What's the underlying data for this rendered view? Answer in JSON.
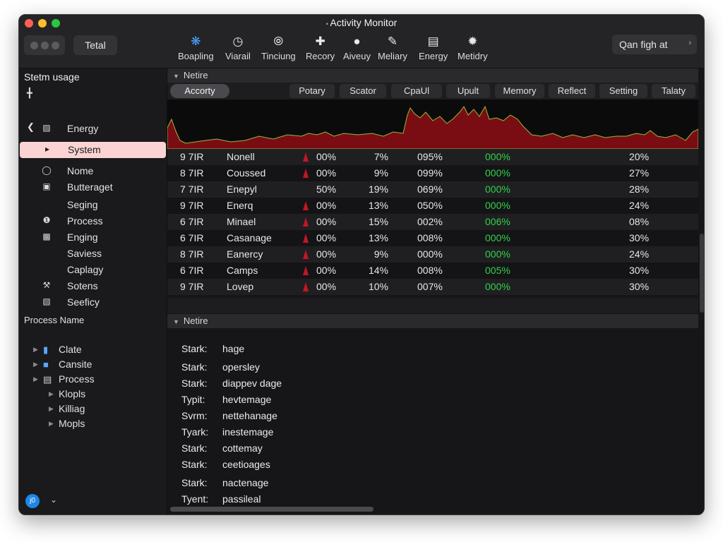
{
  "window": {
    "title": "Activity Monitor"
  },
  "toolbar": {
    "total_label": "Tetal",
    "tools": [
      {
        "label": "Boapling",
        "icon": "cpu-gear-icon"
      },
      {
        "label": "Viarail",
        "icon": "clock-icon"
      },
      {
        "label": "Tinciung",
        "icon": "gauge-icon"
      },
      {
        "label": "Recory",
        "icon": "plus-icon"
      },
      {
        "label": "Aiveuy",
        "icon": "apple-icon"
      },
      {
        "label": "Meliary",
        "icon": "edit-icon"
      },
      {
        "label": "Energy",
        "icon": "list-icon"
      },
      {
        "label": "Metidry",
        "icon": "aperture-icon"
      }
    ],
    "search_value": "Qan figh at"
  },
  "sidebar": {
    "heading": "Stetm usage",
    "items": [
      {
        "label": "Energy",
        "icon": "battery-icon"
      },
      {
        "label": "System",
        "icon": "play-icon"
      },
      {
        "label": "Nome",
        "icon": "chat-icon"
      },
      {
        "label": "Butteraget",
        "icon": "box-icon"
      },
      {
        "label": "Seging",
        "icon": ""
      },
      {
        "label": "Process",
        "icon": "info-icon"
      },
      {
        "label": "Enging",
        "icon": "disk-icon"
      },
      {
        "label": "Saviess",
        "icon": ""
      },
      {
        "label": "Caplagy",
        "icon": ""
      },
      {
        "label": "Sotens",
        "icon": "wrench-icon"
      },
      {
        "label": "Seeficy",
        "icon": "book-icon"
      }
    ],
    "section_label": "Process Name",
    "tree": [
      {
        "label": "Clate",
        "icon": "file-icon"
      },
      {
        "label": "Cansite",
        "icon": "folder-icon"
      },
      {
        "label": "Process",
        "icon": "drive-icon"
      },
      {
        "label": "Klopls"
      },
      {
        "label": "Killiag"
      },
      {
        "label": "Mopls"
      }
    ],
    "avatar_text": "j0"
  },
  "main": {
    "section_one": "Netire",
    "section_two": "Netire",
    "columns": [
      "Accorty",
      "Potary",
      "Scator",
      "CpaUl",
      "Upult",
      "Memory",
      "Reflect",
      "Setting",
      "Talaty"
    ],
    "rows": [
      {
        "pid": "9 7IR",
        "name": "Nonell",
        "cpu": "00%",
        "time": "7%",
        "threads": "095%",
        "idle": "000%",
        "pct": "20%",
        "mark": true
      },
      {
        "pid": "8 7IR",
        "name": "Coussed",
        "cpu": "00%",
        "time": "9%",
        "threads": "099%",
        "idle": "000%",
        "pct": "27%",
        "mark": true
      },
      {
        "pid": "7 7IR",
        "name": "Enepyl",
        "cpu": "50%",
        "time": "19%",
        "threads": "069%",
        "idle": "000%",
        "pct": "28%",
        "mark": false
      },
      {
        "pid": "9 7IR",
        "name": "Enerq",
        "cpu": "00%",
        "time": "13%",
        "threads": "050%",
        "idle": "000%",
        "pct": "24%",
        "mark": true
      },
      {
        "pid": "6 7IR",
        "name": "Minael",
        "cpu": "00%",
        "time": "15%",
        "threads": "002%",
        "idle": "006%",
        "pct": "08%",
        "mark": true
      },
      {
        "pid": "6 7IR",
        "name": "Casanage",
        "cpu": "00%",
        "time": "13%",
        "threads": "008%",
        "idle": "000%",
        "pct": "30%",
        "mark": true
      },
      {
        "pid": "8 7IR",
        "name": "Eanercy",
        "cpu": "00%",
        "time": "9%",
        "threads": "000%",
        "idle": "000%",
        "pct": "24%",
        "mark": true
      },
      {
        "pid": "6 7IR",
        "name": "Camps",
        "cpu": "00%",
        "time": "14%",
        "threads": "008%",
        "idle": "005%",
        "pct": "30%",
        "mark": true
      },
      {
        "pid": "9 7IR",
        "name": "Lovep",
        "cpu": "00%",
        "time": "10%",
        "threads": "007%",
        "idle": "000%",
        "pct": "30%",
        "mark": true
      }
    ],
    "details": [
      {
        "key": "Stark:",
        "value": "hage"
      },
      {
        "key": "Stark:",
        "value": "opersley"
      },
      {
        "key": "Stark:",
        "value": "diappev dage"
      },
      {
        "key": "Typit:",
        "value": "hevtemage"
      },
      {
        "key": "Svrm:",
        "value": "nettehanage"
      },
      {
        "key": "Tyark:",
        "value": "inestemage"
      },
      {
        "key": "Stark:",
        "value": "cottemay"
      },
      {
        "key": "Stark:",
        "value": "ceetioages"
      },
      {
        "key": "Stark:",
        "value": "nactenage"
      },
      {
        "key": "Tyent:",
        "value": "passileal"
      }
    ]
  },
  "colors": {
    "accent_red": "#c01822",
    "graph_fill": "#7a0d14",
    "graph_line": "#9ab83a",
    "idle_green": "#2fd34c",
    "selection": "#fbd3d3"
  }
}
